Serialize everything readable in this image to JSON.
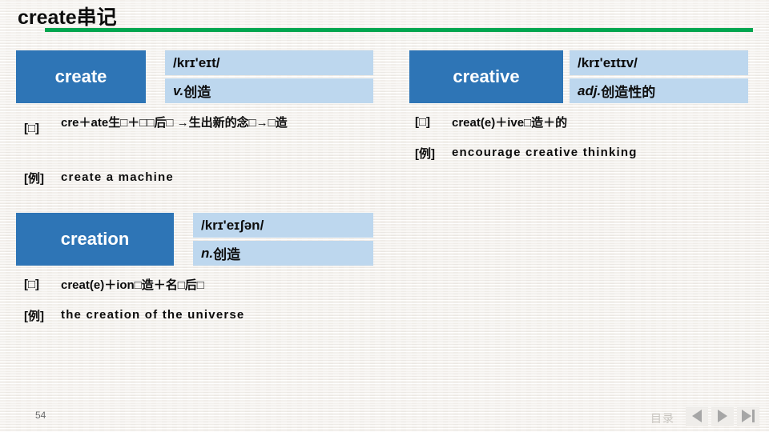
{
  "slide": {
    "title": "create串记",
    "accent_rule_color": "#00A650",
    "label_box_color": "#2E75B6",
    "panel_color": "#BDD7EE",
    "background_color": "#F4F2EF"
  },
  "entries": [
    {
      "word": "create",
      "phonetic": "/krɪ'eɪt/",
      "pos": "v.",
      "meaning": "创造",
      "etymology_tag": "[□]",
      "etymology": "cre＋ate生□＋□□后□ →生出新的念□→□造",
      "example_tag": "[例]",
      "example": "create a machine"
    },
    {
      "word": "creative",
      "phonetic": "/krɪ'eɪtɪv/",
      "pos": "adj.",
      "meaning": "创造性的",
      "etymology_tag": "[□]",
      "etymology": "creat(e)＋ive□造＋的",
      "example_tag": "[例]",
      "example": "encourage creative thinking"
    },
    {
      "word": "creation",
      "phonetic": "/krɪ'eɪʃən/",
      "pos": "n.",
      "meaning": "创造",
      "etymology_tag": "[□]",
      "etymology": "creat(e)＋ion□造＋名□后□",
      "example_tag": "[例]",
      "example": "the creation of the universe"
    }
  ],
  "footer": {
    "page_number": "54",
    "toc_label": "目录",
    "nav": {
      "previous": "previous-slide",
      "next": "next-slide",
      "last": "last-slide"
    }
  }
}
